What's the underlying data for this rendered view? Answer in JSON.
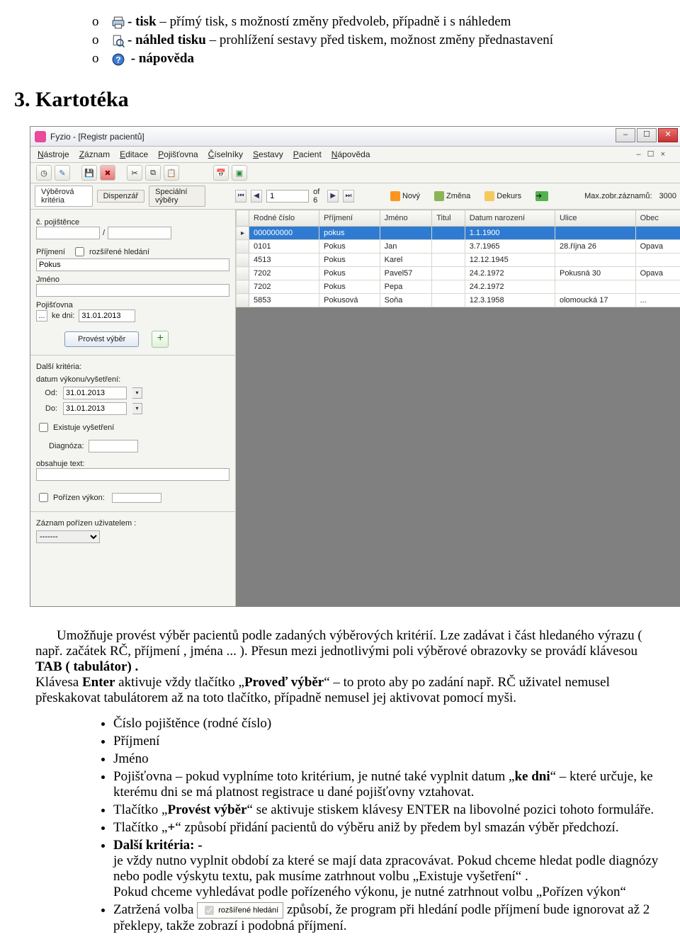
{
  "top_bullets": [
    {
      "marker": "o",
      "bold": "- tisk",
      "rest": " – přímý tisk, s možností změny předvoleb, případně i s náhledem",
      "icon": "printer"
    },
    {
      "marker": "o",
      "bold": "- náhled tisku",
      "rest": " – prohlížení sestavy před tiskem, možnost změny přednastavení",
      "icon": "preview"
    },
    {
      "marker": "o",
      "bold": " - nápověda",
      "rest": "",
      "icon": "help"
    }
  ],
  "section_heading": "3. Kartotéka",
  "app_window": {
    "title": "Fyzio  - [Registr pacientů]",
    "menus": [
      "Nástroje",
      "Záznam",
      "Editace",
      "Pojišťovna",
      "Číselníky",
      "Sestavy",
      "Pacient",
      "Nápověda"
    ],
    "mdi": [
      "–",
      "☐",
      "×"
    ]
  },
  "navbar": {
    "tabs": [
      "Výběrová kritéria",
      "Dispenzář",
      "Speciální výběry"
    ],
    "page": "1",
    "of": "of 6",
    "actions": [
      {
        "label": "Nový"
      },
      {
        "label": "Změna"
      },
      {
        "label": "Dekurs"
      }
    ],
    "max_label": "Max.zobr.záznamů:",
    "max_value": "3000"
  },
  "leftpanel": {
    "lbl_cp": "č. pojištěnce",
    "cp_sep": "/",
    "lbl_prijmeni": "Příjmení",
    "chk_ext": "rozšířené hledání",
    "val_prijmeni": "Pokus",
    "lbl_jmeno": "Jméno",
    "lbl_poj": "Pojišťovna",
    "lbl_kedni": "ke dni:",
    "val_kedni": "31.01.2013",
    "btn_select": "Provést výběr",
    "lbl_dalsi": "Další kritéria:",
    "lbl_datumvyk": "datum výkonu/vyšetření:",
    "lbl_od": "Od:",
    "val_od": "31.01.2013",
    "lbl_do": "Do:",
    "val_do": "31.01.2013",
    "chk_exist": "Existuje vyšetření",
    "lbl_diag": "Diagnóza:",
    "lbl_txt": "obsahuje text:",
    "chk_vykon": "Pořízen výkon:",
    "lbl_user": "Záznam pořízen uživatelem :",
    "sel_user": "-------"
  },
  "table": {
    "headers": [
      "Rodné číslo",
      "Příjmení",
      "Jméno",
      "Titul",
      "Datum narození",
      "Ulice",
      "Obec"
    ],
    "rows": [
      {
        "sel": true,
        "cells": [
          "000000000",
          "pokus",
          "",
          "",
          "1.1.1900",
          "",
          ""
        ]
      },
      {
        "sel": false,
        "cells": [
          "0101",
          "Pokus",
          "Jan",
          "",
          "3.7.1965",
          "28.října 26",
          "Opava"
        ]
      },
      {
        "sel": false,
        "cells": [
          "4513",
          "Pokus",
          "Karel",
          "",
          "12.12.1945",
          "",
          ""
        ]
      },
      {
        "sel": false,
        "cells": [
          "7202",
          "Pokus",
          "Pavel57",
          "",
          "24.2.1972",
          "Pokusná 30",
          "Opava"
        ]
      },
      {
        "sel": false,
        "cells": [
          "7202",
          "Pokus",
          "Pepa",
          "",
          "24.2.1972",
          "",
          ""
        ]
      },
      {
        "sel": false,
        "cells": [
          "5853",
          "Pokusová",
          "Soňa",
          "",
          "12.3.1958",
          "olomoucká 17",
          "..."
        ]
      }
    ]
  },
  "body": {
    "p1a": "Umožňuje provést výběr pacientů podle zadaných výběrových kritérií. Lze zadávat i část hledaného výrazu ( např. začátek  RČ, příjmení , jména ... ). Přesun mezi jednotlivými poli výběrové obrazovky se provádí klávesou ",
    "p1b": "TAB ( tabulátor) .",
    "p2a": "Klávesa ",
    "p2b": "Enter",
    "p2c": " aktivuje vždy tlačítko „",
    "p2d": "Proveď výběr",
    "p2e": "“ – to proto aby po zadání např. RČ uživatel nemusel přeskakovat tabulátorem až na toto tlačítko, případně nemusel jej aktivovat pomocí myši.",
    "li1": "Číslo pojištěnce (rodné číslo)",
    "li2": "Příjmení",
    "li3": "Jméno",
    "li4a": "Pojišťovna – pokud vyplníme toto kritérium, je nutné také vyplnit datum „",
    "li4b": "ke dni",
    "li4c": "“ –  které určuje, ke kterému dni  se má platnost registrace u dané pojišťovny vztahovat.",
    "li5a": "Tlačítko „",
    "li5b": "Provést výběr",
    "li5c": "“ se aktivuje stiskem klávesy ENTER na libovolné pozici tohoto formuláře.",
    "li6a": "Tlačítko „",
    "li6b": "+",
    "li6c": "“ způsobí přidání pacientů do výběru aniž by předem byl smazán výběr předchozí.",
    "li7a": "Další kritéria: -",
    "li7b": "je vždy nutno vyplnit období za které se mají data zpracovávat. Pokud chceme hledat podle diagnózy nebo podle výskytu textu, pak musíme zatrhnout volbu „Existuje vyšetření“ .",
    "li7c": "Pokud chceme vyhledávat podle pořízeného výkonu, je nutné zatrhnout volbu „Pořízen výkon“",
    "li8a": "Zatržená volba ",
    "li8chk": "rozšířené hledání",
    "li8b": " způsobí, že program při hledání podle příjmení bude ignorovat až 2 překlepy, takže zobrazí i podobná příjmení."
  }
}
